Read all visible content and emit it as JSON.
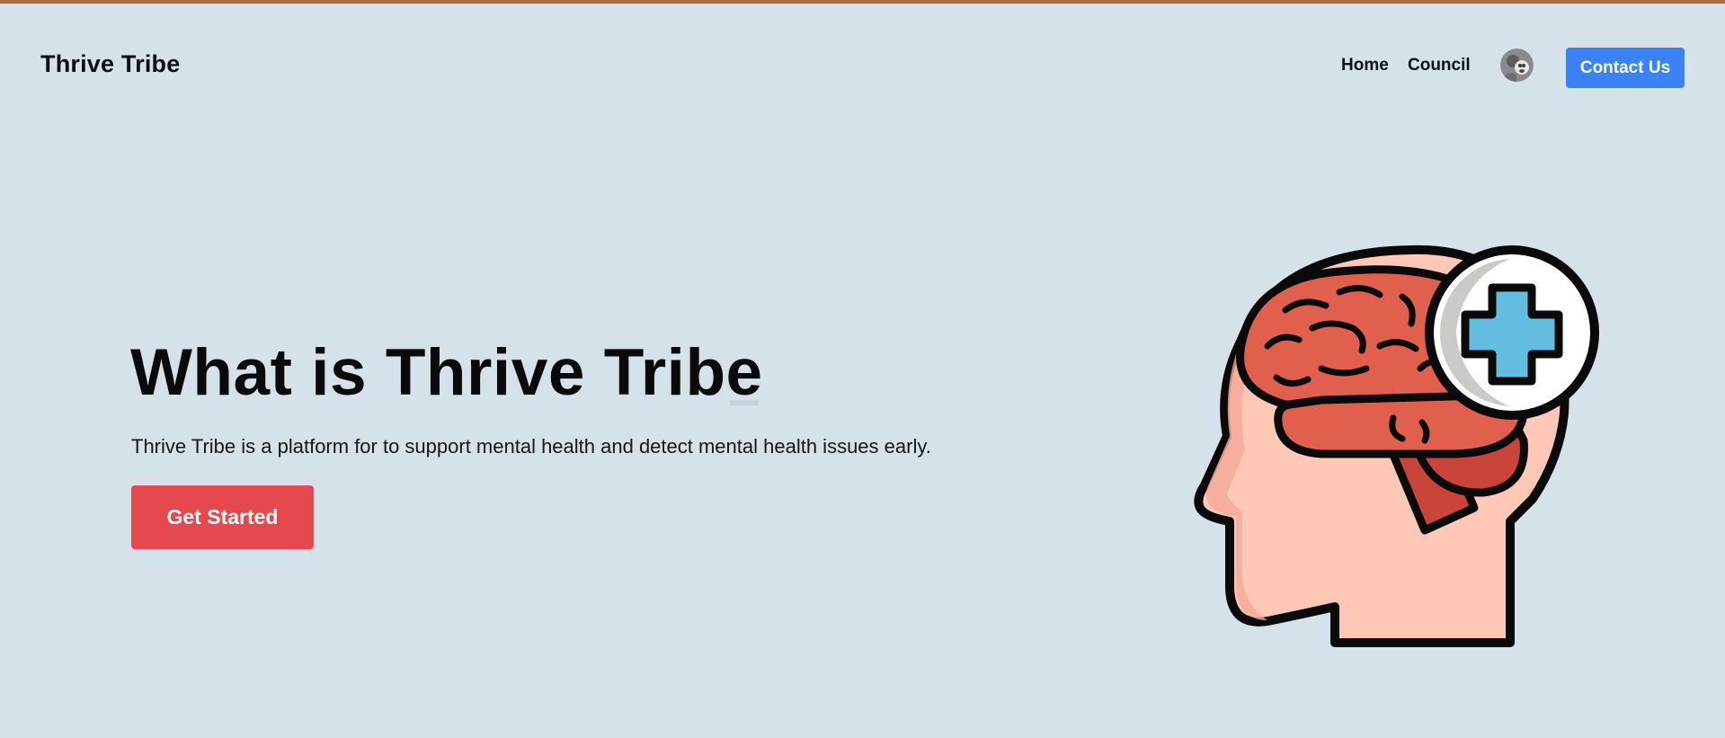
{
  "brand": {
    "name": "Thrive Tribe"
  },
  "nav": {
    "items": [
      {
        "label": "Home"
      },
      {
        "label": "Council"
      }
    ],
    "contact_label": "Contact Us"
  },
  "hero": {
    "title": "What is Thrive Tribe",
    "description": "Thrive Tribe is a platform for to support mental health and detect mental health issues early.",
    "cta_label": "Get Started",
    "illustration": "head-brain-medical-cross-icon"
  },
  "colors": {
    "background": "#d5e2ea",
    "contact_button": "#3b82f6",
    "cta_button": "#e5484d",
    "top_strip": "#b0693f"
  },
  "icons": {
    "avatar": "user-avatar"
  }
}
